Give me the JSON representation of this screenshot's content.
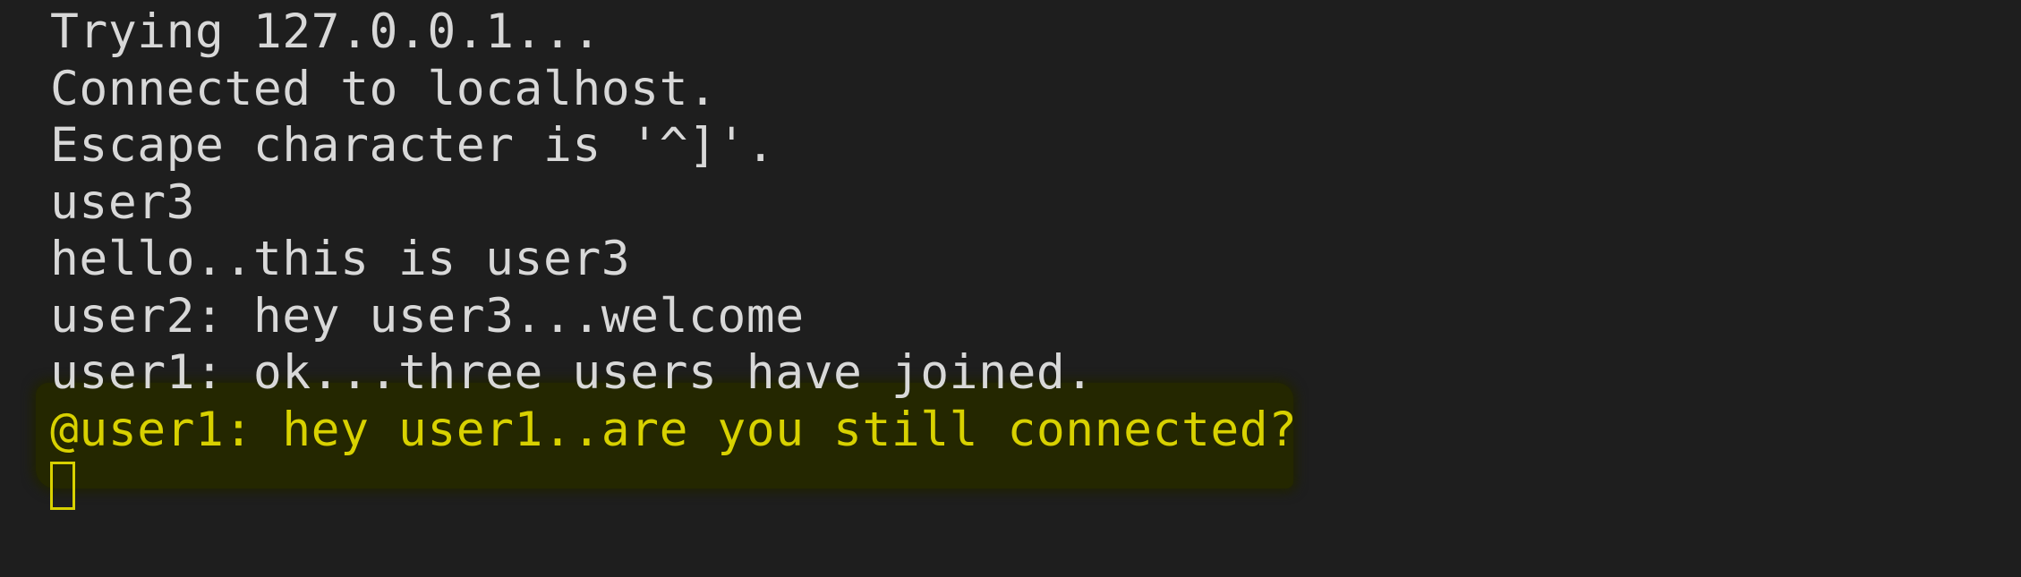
{
  "terminal": {
    "lines": [
      "Trying 127.0.0.1...",
      "Connected to localhost.",
      "Escape character is '^]'.",
      "user3",
      "hello..this is user3",
      "user2: hey user3...welcome",
      "user1: ok...three users have joined."
    ],
    "input_line": "@user1: hey user1..are you still connected?"
  },
  "colors": {
    "background": "#1e1e1e",
    "text": "#d8d8d8",
    "input_text": "#d8d100",
    "highlight": "#242700"
  }
}
